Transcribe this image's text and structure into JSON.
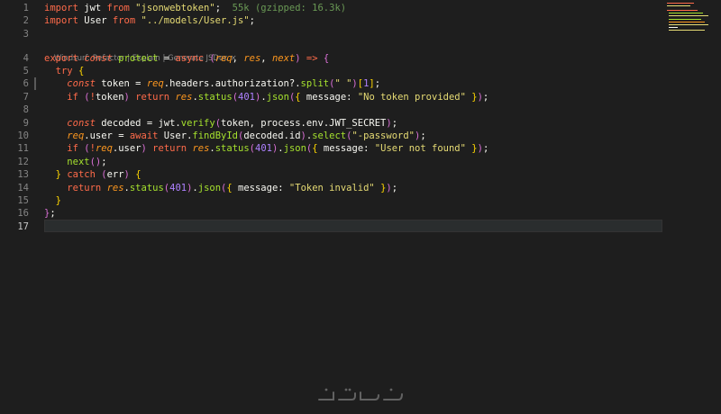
{
  "editor": {
    "active_line": 17,
    "codelens": {
      "items": [
        "Windsurf: Refactor",
        "Explain",
        "Generate JSDoc"
      ],
      "separator": " | ",
      "close": "×"
    },
    "lines": [
      {
        "n": "1",
        "tokens": [
          [
            "kw",
            "import"
          ],
          [
            "id",
            " jwt "
          ],
          [
            "kw",
            "from"
          ],
          [
            "pn",
            " "
          ],
          [
            "str",
            "\"jsonwebtoken\""
          ],
          [
            "pn",
            ";"
          ],
          [
            "cm",
            "  55k (gzipped: 16.3k)"
          ]
        ]
      },
      {
        "n": "2",
        "tokens": [
          [
            "kw",
            "import"
          ],
          [
            "id",
            " User "
          ],
          [
            "kw",
            "from"
          ],
          [
            "pn",
            " "
          ],
          [
            "str",
            "\"../models/User.js\""
          ],
          [
            "pn",
            ";"
          ]
        ]
      },
      {
        "n": "3",
        "tokens": []
      },
      {
        "n": "4",
        "tokens": [
          [
            "kw",
            "export"
          ],
          [
            "pn",
            " "
          ],
          [
            "kw2",
            "const"
          ],
          [
            "pn",
            " "
          ],
          [
            "fn",
            "protect"
          ],
          [
            "pn",
            " = "
          ],
          [
            "kw",
            "async"
          ],
          [
            "pn",
            " "
          ],
          [
            "brk",
            "("
          ],
          [
            "it",
            "req"
          ],
          [
            "pn",
            ", "
          ],
          [
            "it",
            "res"
          ],
          [
            "pn",
            ", "
          ],
          [
            "it",
            "next"
          ],
          [
            "brk",
            ")"
          ],
          [
            "pn",
            " "
          ],
          [
            "kw",
            "=>"
          ],
          [
            "pn",
            " "
          ],
          [
            "brk",
            "{"
          ]
        ]
      },
      {
        "n": "5",
        "tokens": [
          [
            "pn",
            "  "
          ],
          [
            "kw",
            "try"
          ],
          [
            "pn",
            " "
          ],
          [
            "brk2",
            "{"
          ]
        ]
      },
      {
        "n": "6",
        "tokens": [
          [
            "pn",
            "    "
          ],
          [
            "kw2",
            "const"
          ],
          [
            "id",
            " token "
          ],
          [
            "pn",
            "= "
          ],
          [
            "it",
            "req"
          ],
          [
            "id",
            ".headers.authorization?."
          ],
          [
            "fn",
            "split"
          ],
          [
            "brk",
            "("
          ],
          [
            "str",
            "\" \""
          ],
          [
            "brk",
            ")"
          ],
          [
            "brk2",
            "["
          ],
          [
            "num",
            "1"
          ],
          [
            "brk2",
            "]"
          ],
          [
            "pn",
            ";"
          ]
        ]
      },
      {
        "n": "7",
        "tokens": [
          [
            "pn",
            "    "
          ],
          [
            "kw",
            "if"
          ],
          [
            "pn",
            " "
          ],
          [
            "brk",
            "("
          ],
          [
            "kw",
            "!"
          ],
          [
            "id",
            "token"
          ],
          [
            "brk",
            ")"
          ],
          [
            "pn",
            " "
          ],
          [
            "kw",
            "return"
          ],
          [
            "pn",
            " "
          ],
          [
            "it",
            "res"
          ],
          [
            "pn",
            "."
          ],
          [
            "fn",
            "status"
          ],
          [
            "brk",
            "("
          ],
          [
            "num",
            "401"
          ],
          [
            "brk",
            ")"
          ],
          [
            "pn",
            "."
          ],
          [
            "fn",
            "json"
          ],
          [
            "brk",
            "("
          ],
          [
            "brk2",
            "{"
          ],
          [
            "id",
            " message: "
          ],
          [
            "str",
            "\"No token provided\""
          ],
          [
            "brk2",
            " }"
          ],
          [
            "brk",
            ")"
          ],
          [
            "pn",
            ";"
          ]
        ]
      },
      {
        "n": "8",
        "tokens": []
      },
      {
        "n": "9",
        "tokens": [
          [
            "pn",
            "    "
          ],
          [
            "kw2",
            "const"
          ],
          [
            "id",
            " decoded "
          ],
          [
            "pn",
            "= "
          ],
          [
            "id",
            "jwt."
          ],
          [
            "fn",
            "verify"
          ],
          [
            "brk",
            "("
          ],
          [
            "id",
            "token, process.env.JWT_SECRET"
          ],
          [
            "brk",
            ")"
          ],
          [
            "pn",
            ";"
          ]
        ]
      },
      {
        "n": "10",
        "tokens": [
          [
            "pn",
            "    "
          ],
          [
            "it",
            "req"
          ],
          [
            "id",
            ".user "
          ],
          [
            "pn",
            "= "
          ],
          [
            "kw",
            "await"
          ],
          [
            "id",
            " User."
          ],
          [
            "fn",
            "findById"
          ],
          [
            "brk",
            "("
          ],
          [
            "id",
            "decoded.id"
          ],
          [
            "brk",
            ")"
          ],
          [
            "pn",
            "."
          ],
          [
            "fn",
            "select"
          ],
          [
            "brk",
            "("
          ],
          [
            "str",
            "\"-password\""
          ],
          [
            "brk",
            ")"
          ],
          [
            "pn",
            ";"
          ]
        ]
      },
      {
        "n": "11",
        "tokens": [
          [
            "pn",
            "    "
          ],
          [
            "kw",
            "if"
          ],
          [
            "pn",
            " "
          ],
          [
            "brk",
            "("
          ],
          [
            "kw",
            "!"
          ],
          [
            "it",
            "req"
          ],
          [
            "id",
            ".user"
          ],
          [
            "brk",
            ")"
          ],
          [
            "pn",
            " "
          ],
          [
            "kw",
            "return"
          ],
          [
            "pn",
            " "
          ],
          [
            "it",
            "res"
          ],
          [
            "pn",
            "."
          ],
          [
            "fn",
            "status"
          ],
          [
            "brk",
            "("
          ],
          [
            "num",
            "401"
          ],
          [
            "brk",
            ")"
          ],
          [
            "pn",
            "."
          ],
          [
            "fn",
            "json"
          ],
          [
            "brk",
            "("
          ],
          [
            "brk2",
            "{"
          ],
          [
            "id",
            " message: "
          ],
          [
            "str",
            "\"User not found\""
          ],
          [
            "brk2",
            " }"
          ],
          [
            "brk",
            ")"
          ],
          [
            "pn",
            ";"
          ]
        ]
      },
      {
        "n": "12",
        "tokens": [
          [
            "pn",
            "    "
          ],
          [
            "fn",
            "next"
          ],
          [
            "brk",
            "()"
          ],
          [
            "pn",
            ";"
          ]
        ]
      },
      {
        "n": "13",
        "tokens": [
          [
            "pn",
            "  "
          ],
          [
            "brk2",
            "}"
          ],
          [
            "pn",
            " "
          ],
          [
            "kw",
            "catch"
          ],
          [
            "pn",
            " "
          ],
          [
            "brk",
            "("
          ],
          [
            "id",
            "err"
          ],
          [
            "brk",
            ")"
          ],
          [
            "pn",
            " "
          ],
          [
            "brk2",
            "{"
          ]
        ]
      },
      {
        "n": "14",
        "tokens": [
          [
            "pn",
            "    "
          ],
          [
            "kw",
            "return"
          ],
          [
            "pn",
            " "
          ],
          [
            "it",
            "res"
          ],
          [
            "pn",
            "."
          ],
          [
            "fn",
            "status"
          ],
          [
            "brk",
            "("
          ],
          [
            "num",
            "401"
          ],
          [
            "brk",
            ")"
          ],
          [
            "pn",
            "."
          ],
          [
            "fn",
            "json"
          ],
          [
            "brk",
            "("
          ],
          [
            "brk2",
            "{"
          ],
          [
            "id",
            " message: "
          ],
          [
            "str",
            "\"Token invalid\""
          ],
          [
            "brk2",
            " }"
          ],
          [
            "brk",
            ")"
          ],
          [
            "pn",
            ";"
          ]
        ]
      },
      {
        "n": "15",
        "tokens": [
          [
            "pn",
            "  "
          ],
          [
            "brk2",
            "}"
          ]
        ]
      },
      {
        "n": "16",
        "tokens": [
          [
            "brk",
            "}"
          ],
          [
            "pn",
            ";"
          ]
        ]
      },
      {
        "n": "17",
        "tokens": []
      }
    ]
  },
  "colors": {
    "background": "#1e1e1e",
    "keyword": "#ff6b4a",
    "string": "#e6db74",
    "number": "#ae81ff",
    "function": "#a6e22e",
    "parameter": "#fd971f"
  },
  "icons": {
    "watermark": "khamsat-logo"
  }
}
